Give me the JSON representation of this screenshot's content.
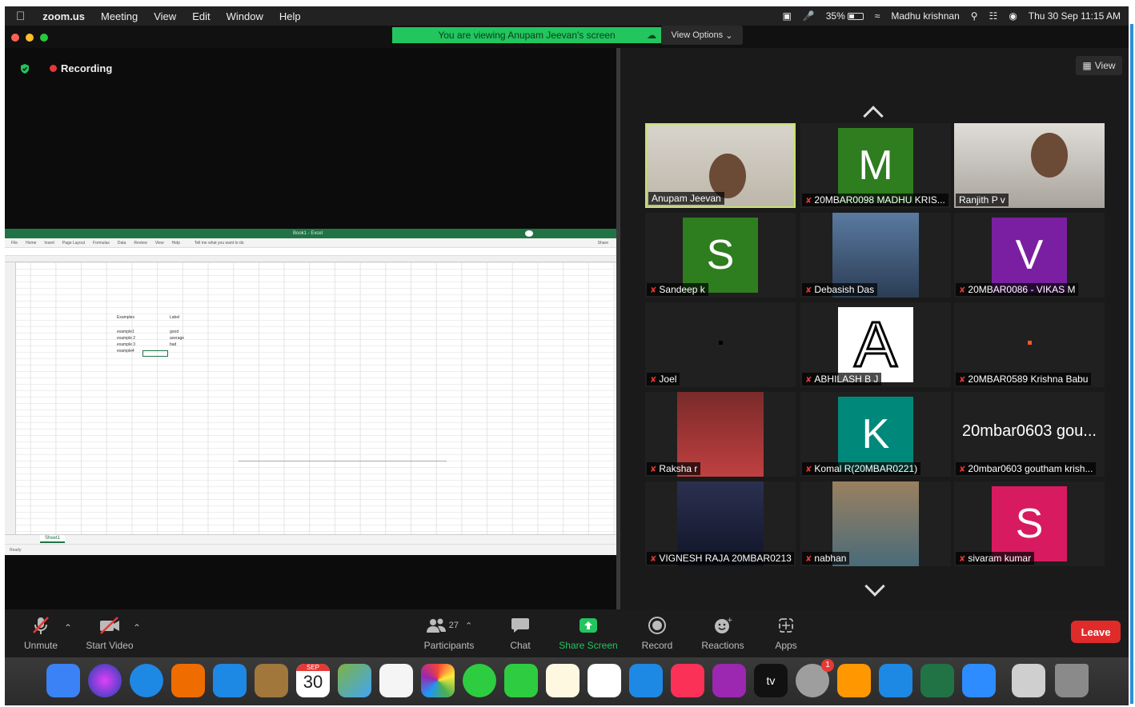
{
  "menubar": {
    "app": "zoom.us",
    "items": [
      "Meeting",
      "View",
      "Edit",
      "Window",
      "Help"
    ],
    "battery": "35%",
    "user": "Madhu krishnan",
    "datetime": "Thu 30 Sep  11:15 AM",
    "battery_level": 0.35
  },
  "banner": {
    "viewing": "You are viewing Anupam Jeevan's screen",
    "view_options": "View Options"
  },
  "recording": {
    "label": "Recording"
  },
  "gallery": {
    "view_label": "View",
    "participants": [
      {
        "name": "Anupam Jeevan",
        "kind": "video",
        "muted": false,
        "active": true
      },
      {
        "name": "20MBAR0098 MADHU KRIS...",
        "kind": "letter",
        "letter": "M",
        "color": "#2e7d1e",
        "muted": true
      },
      {
        "name": "Ranjith P v",
        "kind": "video",
        "muted": false
      },
      {
        "name": "Sandeep k",
        "kind": "letter",
        "letter": "S",
        "color": "#2e7d1e",
        "muted": true
      },
      {
        "name": "Debasish Das",
        "kind": "photo",
        "muted": true
      },
      {
        "name": "20MBAR0086 - VIKAS M",
        "kind": "letter",
        "letter": "V",
        "color": "#7b1fa2",
        "muted": true
      },
      {
        "name": "Joel",
        "kind": "blank",
        "muted": true
      },
      {
        "name": "ABHILASH B J",
        "kind": "letter",
        "letter": "A",
        "color": "#ffffff",
        "muted": true
      },
      {
        "name": "20MBAR0589 Krishna Babu",
        "kind": "blank",
        "muted": true
      },
      {
        "name": "Raksha r",
        "kind": "photo",
        "muted": true
      },
      {
        "name": "Komal R(20MBAR0221)",
        "kind": "letter",
        "letter": "K",
        "color": "#00897b",
        "muted": true
      },
      {
        "name": "20mbar0603 goutham krish...",
        "kind": "text",
        "text": "20mbar0603 gou...",
        "muted": true
      },
      {
        "name": "VIGNESH RAJA 20MBAR0213",
        "kind": "photo",
        "muted": true
      },
      {
        "name": "nabhan",
        "kind": "photo",
        "muted": true
      },
      {
        "name": "sivaram kumar",
        "kind": "letter",
        "letter": "S",
        "color": "#d81b60",
        "muted": true
      }
    ]
  },
  "toolbar": {
    "unmute": "Unmute",
    "start_video": "Start Video",
    "participants_count": "27",
    "participants": "Participants",
    "chat": "Chat",
    "share_screen": "Share Screen",
    "record": "Record",
    "reactions": "Reactions",
    "apps": "Apps",
    "leave": "Leave"
  },
  "excel": {
    "title": "Book1 - Excel",
    "ribbon": [
      "File",
      "Home",
      "Insert",
      "Page Layout",
      "Formulas",
      "Data",
      "Review",
      "View",
      "Help"
    ],
    "tell_me": "Tell me what you want to do",
    "share": "Share",
    "cells": {
      "h1": "Examples",
      "h2": "Label",
      "r1a": "example1",
      "r1b": "good",
      "r2a": "example 2",
      "r2b": "average",
      "r3a": "example 3",
      "r3b": "bad",
      "r4a": "example4"
    },
    "sheet_tab": "Sheet1",
    "status": "Ready"
  },
  "dock": {
    "calendar_month": "SEP",
    "calendar_day": "30",
    "badge": "1"
  }
}
